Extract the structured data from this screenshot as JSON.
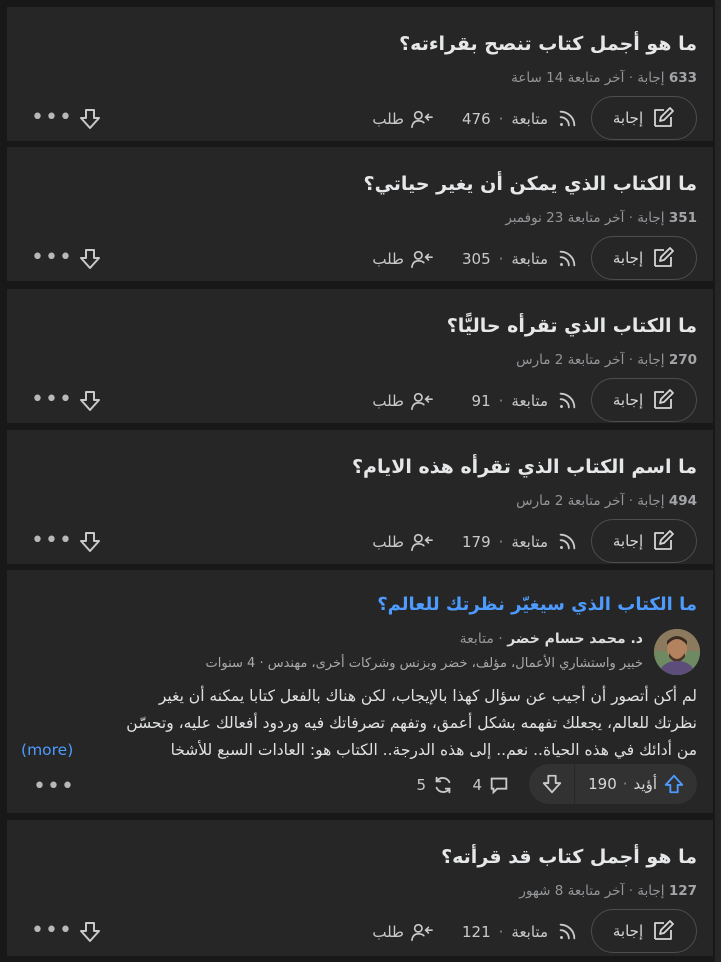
{
  "colors": {
    "background": "#181818",
    "card": "#262626",
    "link": "#4d9bff",
    "upvote": "#4d9bff"
  },
  "questions": [
    {
      "title": "ما هو أجمل كتاب تنصح بقراءته؟",
      "answers_count": "633",
      "answers_label": "إجابة",
      "last_follow": "آخر متابعة 14 ساعة",
      "answer_label": "إجابة",
      "follow_label": "متابعة",
      "follow_count": "476",
      "request_label": "طلب"
    },
    {
      "title": "ما الكتاب الذي يمكن أن يغير حياتي؟",
      "answers_count": "351",
      "answers_label": "إجابة",
      "last_follow": "آخر متابعة 23 نوفمبر",
      "answer_label": "إجابة",
      "follow_label": "متابعة",
      "follow_count": "305",
      "request_label": "طلب"
    },
    {
      "title": "ما الكتاب الذي تقرأه حاليًّا؟",
      "answers_count": "270",
      "answers_label": "إجابة",
      "last_follow": "آخر متابعة 2 مارس",
      "answer_label": "إجابة",
      "follow_label": "متابعة",
      "follow_count": "91",
      "request_label": "طلب"
    },
    {
      "title": "ما اسم الكتاب الذي تقرأه هذه الايام؟",
      "answers_count": "494",
      "answers_label": "إجابة",
      "last_follow": "آخر متابعة 2 مارس",
      "answer_label": "إجابة",
      "follow_label": "متابعة",
      "follow_count": "179",
      "request_label": "طلب"
    },
    {
      "title": "ما هو أجمل كتاب قد قرأته؟",
      "answers_count": "127",
      "answers_label": "إجابة",
      "last_follow": "آخر متابعة 8 شهور",
      "answer_label": "إجابة",
      "follow_label": "متابعة",
      "follow_count": "121",
      "request_label": "طلب"
    }
  ],
  "answer": {
    "question_title": "ما الكتاب الذي سيغيّر نظرتك للعالم؟",
    "author": "د. محمد حسام خضر",
    "follow": "متابعة",
    "credential": "خبير واستشاري الأعمال، مؤلف، خضر وبزنس وشركات أخرى، مهندس · 4 سنوات",
    "line1": "لم أكن أتصور أن أجيب عن سؤال كهذا بالإيجاب، لكن هناك بالفعل كتابا يمكنه أن يغير",
    "line2": "نظرتك للعالم، يجعلك تفهمه بشكل أعمق، وتفهم تصرفاتك فيه وردود أفعالك عليه، وتحسّن",
    "line3": "من أدائك في هذه الحياة.. نعم.. إلى هذه الدرجة.. الكتاب هو: العادات السبع للأشخا",
    "more": "(more)",
    "upvote_label": "أؤيد",
    "upvote_count": "190",
    "comments": "4",
    "shares": "5"
  },
  "icons": {
    "answer": "pencil-square-icon",
    "follow": "rss-icon",
    "request": "user-plus-icon",
    "downvote": "arrow-down-icon",
    "upvote": "arrow-up-icon",
    "comment": "comment-icon",
    "share": "share-loop-icon",
    "more": "ellipsis-icon"
  }
}
